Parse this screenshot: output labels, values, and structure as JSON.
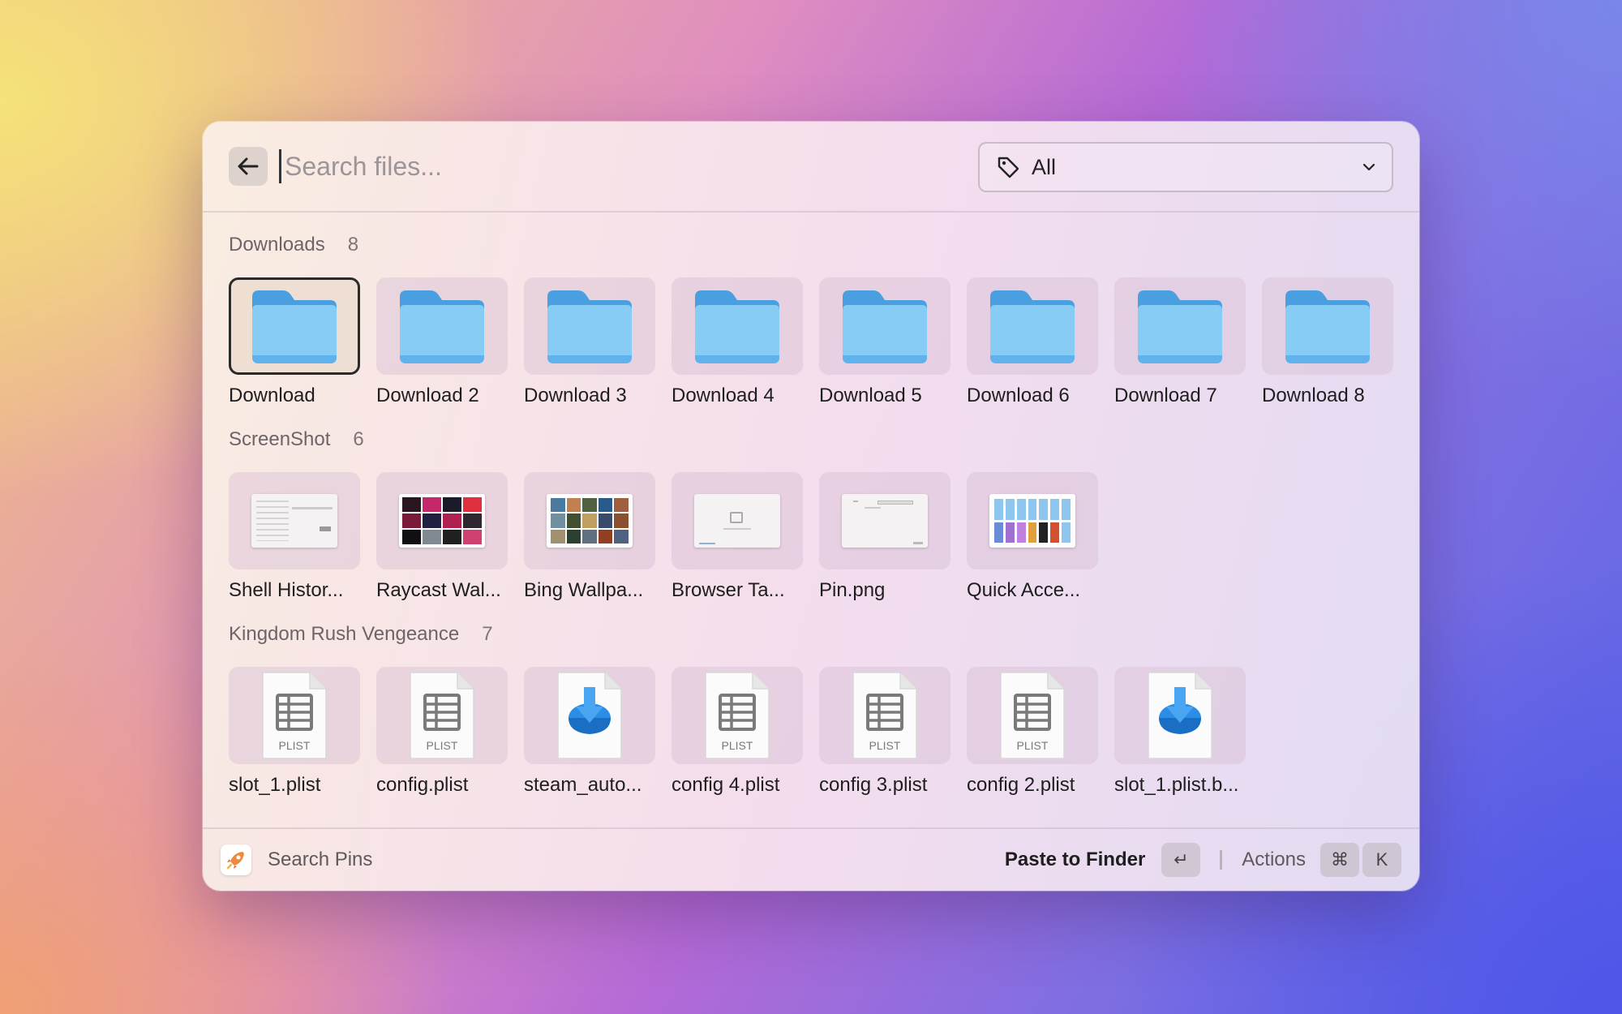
{
  "search": {
    "placeholder": "Search files..."
  },
  "filter": {
    "value": "All"
  },
  "sections": [
    {
      "title": "Downloads",
      "count": "8",
      "items": [
        {
          "label": "Download",
          "icon": "folder-icon"
        },
        {
          "label": "Download 2",
          "icon": "folder-icon"
        },
        {
          "label": "Download 3",
          "icon": "folder-icon"
        },
        {
          "label": "Download 4",
          "icon": "folder-icon"
        },
        {
          "label": "Download 5",
          "icon": "folder-icon"
        },
        {
          "label": "Download 6",
          "icon": "folder-icon"
        },
        {
          "label": "Download 7",
          "icon": "folder-icon"
        },
        {
          "label": "Download 8",
          "icon": "folder-icon"
        }
      ]
    },
    {
      "title": "ScreenShot",
      "count": "6",
      "items": [
        {
          "label": "Shell Histor...",
          "icon": "screenshot-thumbnail"
        },
        {
          "label": "Raycast Wal...",
          "icon": "screenshot-thumbnail"
        },
        {
          "label": "Bing Wallpa...",
          "icon": "screenshot-thumbnail"
        },
        {
          "label": "Browser Ta...",
          "icon": "screenshot-thumbnail"
        },
        {
          "label": "Pin.png",
          "icon": "screenshot-thumbnail"
        },
        {
          "label": "Quick Acce...",
          "icon": "screenshot-thumbnail"
        }
      ]
    },
    {
      "title": "Kingdom Rush Vengeance",
      "count": "7",
      "items": [
        {
          "label": "slot_1.plist",
          "icon": "plist-file-icon",
          "badge": "PLIST"
        },
        {
          "label": "config.plist",
          "icon": "plist-file-icon",
          "badge": "PLIST"
        },
        {
          "label": "steam_auto...",
          "icon": "download-file-icon"
        },
        {
          "label": "config 4.plist",
          "icon": "plist-file-icon",
          "badge": "PLIST"
        },
        {
          "label": "config 3.plist",
          "icon": "plist-file-icon",
          "badge": "PLIST"
        },
        {
          "label": "config 2.plist",
          "icon": "plist-file-icon",
          "badge": "PLIST"
        },
        {
          "label": "slot_1.plist.b...",
          "icon": "download-file-icon"
        }
      ]
    }
  ],
  "footer": {
    "pins_label": "Search Pins",
    "paste_label": "Paste to Finder",
    "enter_key": "↵",
    "actions_label": "Actions",
    "cmd_key": "⌘",
    "k_key": "K"
  }
}
